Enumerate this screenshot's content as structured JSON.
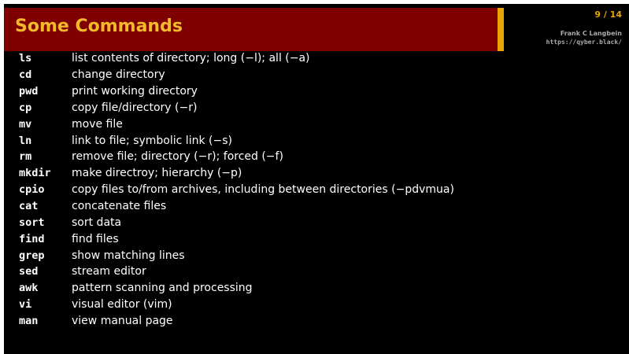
{
  "header": {
    "title": "Some Commands",
    "page": "9 / 14",
    "author": "Frank C Langbein",
    "url": "https://qyber.black/"
  },
  "commands": [
    {
      "name": "ls",
      "desc": "list contents of directory; long (−l); all (−a)"
    },
    {
      "name": "cd",
      "desc": "change directory"
    },
    {
      "name": "pwd",
      "desc": "print working directory"
    },
    {
      "name": "cp",
      "desc": "copy file/directory (−r)"
    },
    {
      "name": "mv",
      "desc": "move file"
    },
    {
      "name": "ln",
      "desc": "link to file; symbolic link (−s)"
    },
    {
      "name": "rm",
      "desc": "remove file; directory (−r); forced (−f)"
    },
    {
      "name": "mkdir",
      "desc": "make directroy; hierarchy (−p)"
    },
    {
      "name": "cpio",
      "desc": "copy files to/from archives, including between directories (−pdvmua)"
    },
    {
      "name": "cat",
      "desc": "concatenate files"
    },
    {
      "name": "sort",
      "desc": "sort data"
    },
    {
      "name": "find",
      "desc": "find files"
    },
    {
      "name": "grep",
      "desc": "show matching lines"
    },
    {
      "name": "sed",
      "desc": "stream editor"
    },
    {
      "name": "awk",
      "desc": "pattern scanning and processing"
    },
    {
      "name": "vi",
      "desc": "visual editor (vim)"
    },
    {
      "name": "man",
      "desc": "view manual page"
    }
  ]
}
